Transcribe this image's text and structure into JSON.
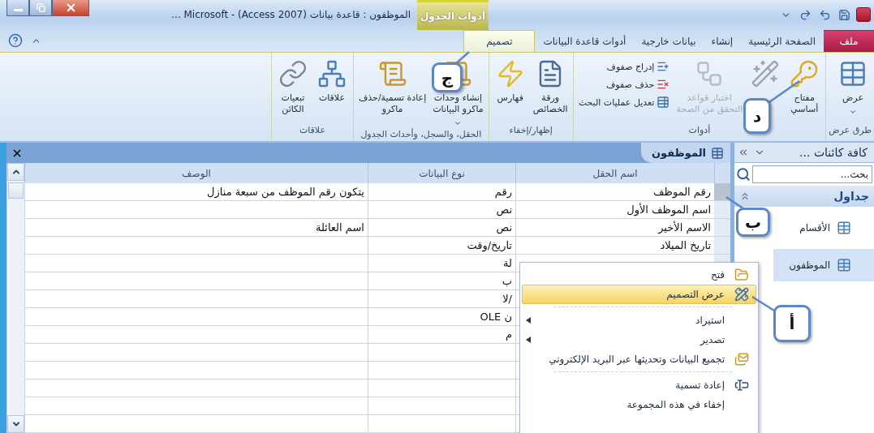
{
  "window": {
    "title": "الموظفون : قاعدة بيانات (Access 2007) - Microsoft ...",
    "contextual_group": "أدوات الجدول"
  },
  "ribbon_tabs": [
    {
      "label": "ملف",
      "kind": "file",
      "selected": false
    },
    {
      "label": "الصفحة الرئيسية",
      "kind": "tab",
      "selected": false
    },
    {
      "label": "إنشاء",
      "kind": "tab",
      "selected": false
    },
    {
      "label": "بيانات خارجية",
      "kind": "tab",
      "selected": false
    },
    {
      "label": "أدوات قاعدة البيانات",
      "kind": "tab",
      "selected": false
    },
    {
      "label": "تصميم",
      "kind": "contextual",
      "selected": true
    }
  ],
  "ribbon_groups": [
    {
      "label": "طرق عرض",
      "items": [
        {
          "kind": "large",
          "label": "عرض",
          "dropdown": true,
          "disabled": false
        }
      ]
    },
    {
      "label": "أدوات",
      "items": [
        {
          "kind": "large",
          "label": "مفتاح\nأساسي",
          "dropdown": false,
          "disabled": false
        },
        {
          "kind": "large",
          "dropdown": false,
          "disabled": false
        },
        {
          "kind": "large",
          "label": "اختبار قواعد\nالتحقق من الصحة",
          "dropdown": false,
          "disabled": true
        },
        {
          "kind": "small",
          "label": "إدراج صفوف",
          "dropdown": false,
          "disabled": false
        },
        {
          "kind": "small",
          "label": "حذف صفوف",
          "dropdown": false,
          "disabled": false
        },
        {
          "kind": "small",
          "label": "تعديل عمليات البحث",
          "dropdown": false,
          "disabled": false
        }
      ]
    },
    {
      "label": "إظهار/إخفاء",
      "items": [
        {
          "kind": "large",
          "label": "ورقة\nالخصائص",
          "dropdown": false,
          "disabled": false
        },
        {
          "kind": "large",
          "label": "فهارس",
          "dropdown": false,
          "disabled": false
        }
      ]
    },
    {
      "label": "الحقل، والسجل، وأحداث الجدول",
      "items": [
        {
          "kind": "large",
          "label": "إنشاء وحدات\nماكرو البيانات",
          "dropdown": true,
          "disabled": false
        },
        {
          "kind": "large",
          "label": "إعادة تسمية/حذف\nماكرو",
          "dropdown": false,
          "disabled": false
        }
      ]
    },
    {
      "label": "علاقات",
      "items": [
        {
          "kind": "large",
          "label": "علاقات",
          "dropdown": false,
          "disabled": false
        },
        {
          "kind": "large",
          "label": "تبعيات\nالكائن",
          "dropdown": false,
          "disabled": false
        }
      ]
    }
  ],
  "document": {
    "tab": "الموظفون",
    "columns": [
      "اسم الحقل",
      "نوع البيانات",
      "الوصف"
    ],
    "rows": [
      {
        "field_name": "رقم الموظف",
        "data_type": "رقم",
        "description": "يتكون رقم الموظف من سبعة منازل",
        "selected": true
      },
      {
        "field_name": "اسم الموظف الأول",
        "data_type": "نص",
        "selected": false
      },
      {
        "field_name": "الاسم الأخير",
        "data_type": "نص",
        "description": "اسم العائلة",
        "selected": false
      },
      {
        "field_name": "تاريخ الميلاد",
        "data_type": "تاريخ/وقت",
        "selected": false
      },
      {
        "data_type": "لة",
        "selected": false
      },
      {
        "data_type": "ب"
      },
      {
        "data_type": "/لا"
      },
      {
        "data_type": "ن OLE"
      },
      {
        "data_type": "م"
      }
    ]
  },
  "nav_pane": {
    "title": "كافة كائنات ...",
    "search": {
      "placeholder": "بحث..."
    },
    "group": "جداول",
    "items": [
      {
        "label": "الأقسام",
        "selected": false
      },
      {
        "label": "الموظفون",
        "selected": true
      }
    ]
  },
  "context_menu": [
    {
      "kind": "item",
      "label": "فتح",
      "selected": false,
      "submenu": false
    },
    {
      "kind": "item",
      "label": "عرض التصميم",
      "selected": true,
      "submenu": false
    },
    {
      "kind": "separator"
    },
    {
      "kind": "item",
      "label": "استيراد",
      "selected": false,
      "submenu": true
    },
    {
      "kind": "item",
      "label": "تصدير",
      "selected": false,
      "submenu": true
    },
    {
      "kind": "item",
      "label": "تجميع البيانات وتحديثها عبر البريد الإلكتروني",
      "selected": false,
      "submenu": false
    },
    {
      "kind": "separator"
    },
    {
      "kind": "item",
      "label": "إعادة تسمية",
      "selected": false,
      "submenu": false
    },
    {
      "kind": "item",
      "label": "إخفاء في هذه المجموعة",
      "selected": false,
      "submenu": false
    }
  ],
  "callouts": [
    "ج",
    "د",
    "ب",
    "أ"
  ]
}
